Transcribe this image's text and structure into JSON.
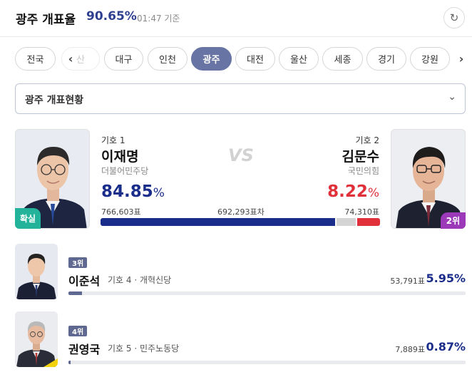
{
  "header": {
    "title": "광주 개표율",
    "rate": "90.65%",
    "time": "01:47 기준"
  },
  "tabs": [
    {
      "label": "전국",
      "active": false
    },
    {
      "label": "산",
      "active": false
    },
    {
      "label": "대구",
      "active": false
    },
    {
      "label": "인천",
      "active": false
    },
    {
      "label": "광주",
      "active": true
    },
    {
      "label": "대전",
      "active": false
    },
    {
      "label": "울산",
      "active": false
    },
    {
      "label": "세종",
      "active": false
    },
    {
      "label": "경기",
      "active": false
    },
    {
      "label": "강원",
      "active": false
    }
  ],
  "dropdown": {
    "label": "광주 개표현황"
  },
  "top": {
    "vs": "VS",
    "gap": "692,293표차",
    "c1": {
      "giho": "기호 1",
      "name": "이재명",
      "party": "더불어민주당",
      "pct": "84.85",
      "pct_unit": "%",
      "votes": "766,603표",
      "badge": "확실",
      "share": 0.8485
    },
    "c2": {
      "giho": "기호 2",
      "name": "김문수",
      "party": "국민의힘",
      "pct": "8.22",
      "pct_unit": "%",
      "votes": "74,310표",
      "badge": "2위",
      "share": 0.0822
    }
  },
  "others": [
    {
      "rank": "3위",
      "name": "이준석",
      "giho": "기호 4",
      "party": "개혁신당",
      "votes": "53,791표",
      "pct": "5.95%",
      "share": 0.0595
    },
    {
      "rank": "4위",
      "name": "권영국",
      "giho": "기호 5",
      "party": "민주노동당",
      "votes": "7,889표",
      "pct": "0.87%",
      "share": 0.0087
    }
  ],
  "colors": {
    "accent": "#6874a3",
    "c1": "#1a2d8a",
    "c2": "#e0303a",
    "win_badge": "#23b39b",
    "rank2_badge": "#9b39b8"
  }
}
